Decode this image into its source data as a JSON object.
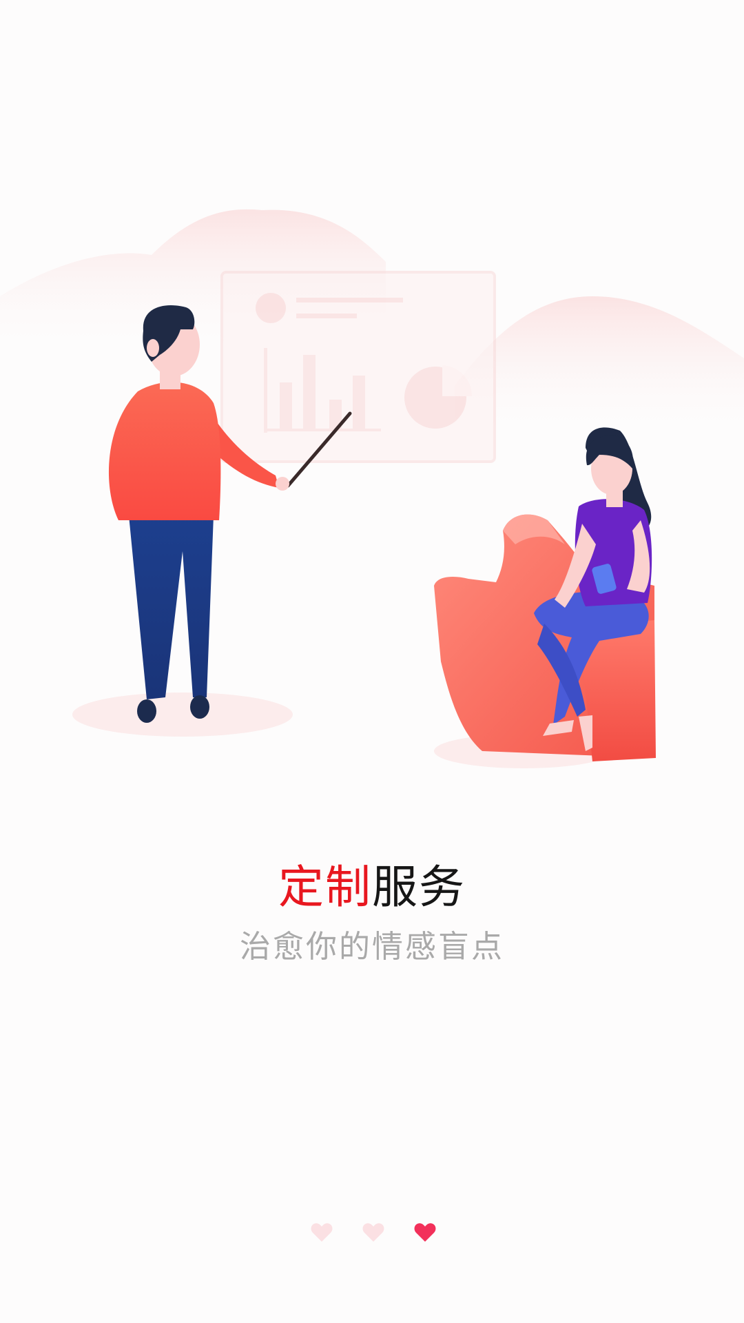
{
  "onboarding": {
    "title_highlight": "定制",
    "title_rest": "服务",
    "subtitle": "治愈你的情感盲点"
  },
  "pager": {
    "total": 3,
    "active_index": 2,
    "icon": "heart-icon"
  },
  "illustration": {
    "subject": "presenter-and-seated-woman",
    "icons": [
      "presentation-board-icon",
      "bar-chart-icon",
      "pie-chart-icon",
      "thumbs-up-icon",
      "phone-icon"
    ]
  },
  "colors": {
    "accent_red": "#e8171f",
    "title_black": "#161616",
    "subtitle_gray": "#a9a9a9",
    "dot_active": "#f2305a",
    "dot_inactive": "#fbe0e3",
    "background": "#fdfcfc"
  }
}
